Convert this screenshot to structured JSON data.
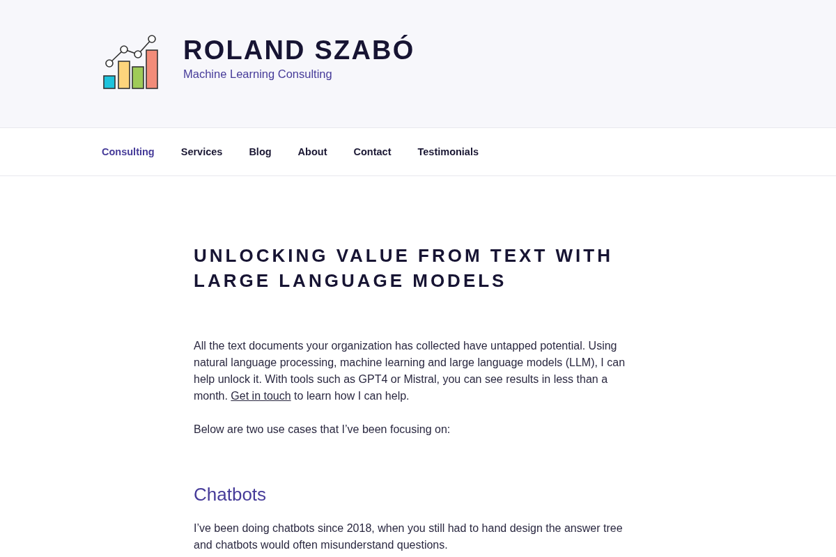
{
  "site_header": {
    "title": "ROLAND SZABÓ",
    "tagline": "Machine Learning Consulting"
  },
  "nav": {
    "items": [
      {
        "label": "Consulting",
        "selected": true
      },
      {
        "label": "Services",
        "selected": false
      },
      {
        "label": "Blog",
        "selected": false
      },
      {
        "label": "About",
        "selected": false
      },
      {
        "label": "Contact",
        "selected": false
      },
      {
        "label": "Testimonials",
        "selected": false
      }
    ]
  },
  "article": {
    "title": "UNLOCKING VALUE FROM TEXT WITH LARGE LANGUAGE MODELS",
    "blocks": [
      {
        "kind": "paragraph",
        "parts": [
          {
            "kind": "text",
            "text": "All the text documents your organization has collected have untapped potential. Using natural language processing, machine learning and large language models (LLM), I can help unlock it. With tools such as GPT4 or Mistral, you can see results in less than a month. "
          },
          {
            "kind": "link",
            "text": "Get in touch"
          },
          {
            "kind": "text",
            "text": " to learn how I can help."
          }
        ]
      },
      {
        "kind": "paragraph",
        "parts": [
          {
            "kind": "text",
            "text": "Below are two use cases that I’ve been focusing on:"
          }
        ]
      },
      {
        "kind": "heading",
        "text": "Chatbots"
      },
      {
        "kind": "paragraph",
        "parts": [
          {
            "kind": "text",
            "text": "I’ve been doing chatbots since 2018, when you still had to hand design the answer tree and chatbots would often misunderstand questions."
          }
        ]
      }
    ]
  }
}
